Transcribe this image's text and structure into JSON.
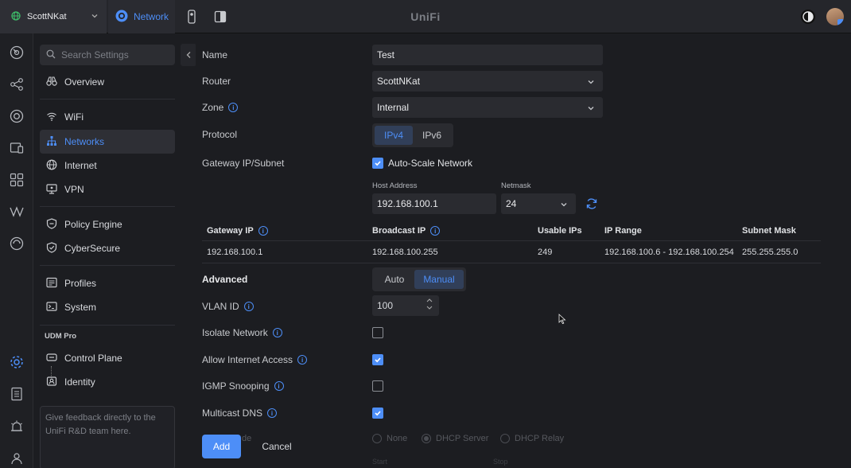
{
  "topbar": {
    "site_name": "ScottNKat",
    "app_tab": "Network",
    "brand": "UniFi"
  },
  "sidebar": {
    "search_placeholder": "Search Settings",
    "items": {
      "overview": "Overview",
      "wifi": "WiFi",
      "networks": "Networks",
      "internet": "Internet",
      "vpn": "VPN",
      "policy_engine": "Policy Engine",
      "cybersecure": "CyberSecure",
      "profiles": "Profiles",
      "system": "System"
    },
    "section_title": "UDM Pro",
    "sub_items": {
      "control_plane": "Control Plane",
      "identity": "Identity"
    },
    "feedback_text": "Give feedback directly to the UniFi R&D team here."
  },
  "form": {
    "name_label": "Name",
    "name_value": "Test",
    "router_label": "Router",
    "router_value": "ScottNKat",
    "zone_label": "Zone",
    "zone_value": "Internal",
    "protocol_label": "Protocol",
    "protocol_options": [
      "IPv4",
      "IPv6"
    ],
    "protocol_selected": "IPv4",
    "gateway_label": "Gateway IP/Subnet",
    "autoscale_label": "Auto-Scale Network",
    "autoscale_checked": true,
    "host_address_label": "Host Address",
    "host_address_value": "192.168.100.1",
    "netmask_label": "Netmask",
    "netmask_value": "24",
    "advanced_label": "Advanced",
    "advanced_options": [
      "Auto",
      "Manual"
    ],
    "advanced_selected": "Manual",
    "vlan_label": "VLAN ID",
    "vlan_value": "100",
    "isolate_label": "Isolate Network",
    "isolate_checked": false,
    "internet_label": "Allow Internet Access",
    "internet_checked": true,
    "igmp_label": "IGMP Snooping",
    "igmp_checked": false,
    "mdns_label": "Multicast DNS",
    "mdns_checked": true,
    "dhcp_mode_label": "de",
    "dhcp_options": [
      "None",
      "DHCP Server",
      "DHCP Relay"
    ],
    "dhcp_selected": "DHCP Server",
    "start_label": "Start",
    "stop_label": "Stop"
  },
  "subnet_table": {
    "headers": {
      "gateway_ip": "Gateway IP",
      "broadcast_ip": "Broadcast IP",
      "usable_ips": "Usable IPs",
      "ip_range": "IP Range",
      "subnet_mask": "Subnet Mask"
    },
    "row": {
      "gateway_ip": "192.168.100.1",
      "broadcast_ip": "192.168.100.255",
      "usable_ips": "249",
      "ip_range": "192.168.100.6 - 192.168.100.254",
      "subnet_mask": "255.255.255.0"
    }
  },
  "actions": {
    "add": "Add",
    "cancel": "Cancel"
  },
  "icons": {
    "site": "globe-icon",
    "app": "network-app-icon",
    "theme": "theme-toggle-icon"
  },
  "colors": {
    "accent": "#4d8ef7",
    "background": "#1c1d21",
    "topbar": "#25262b"
  }
}
